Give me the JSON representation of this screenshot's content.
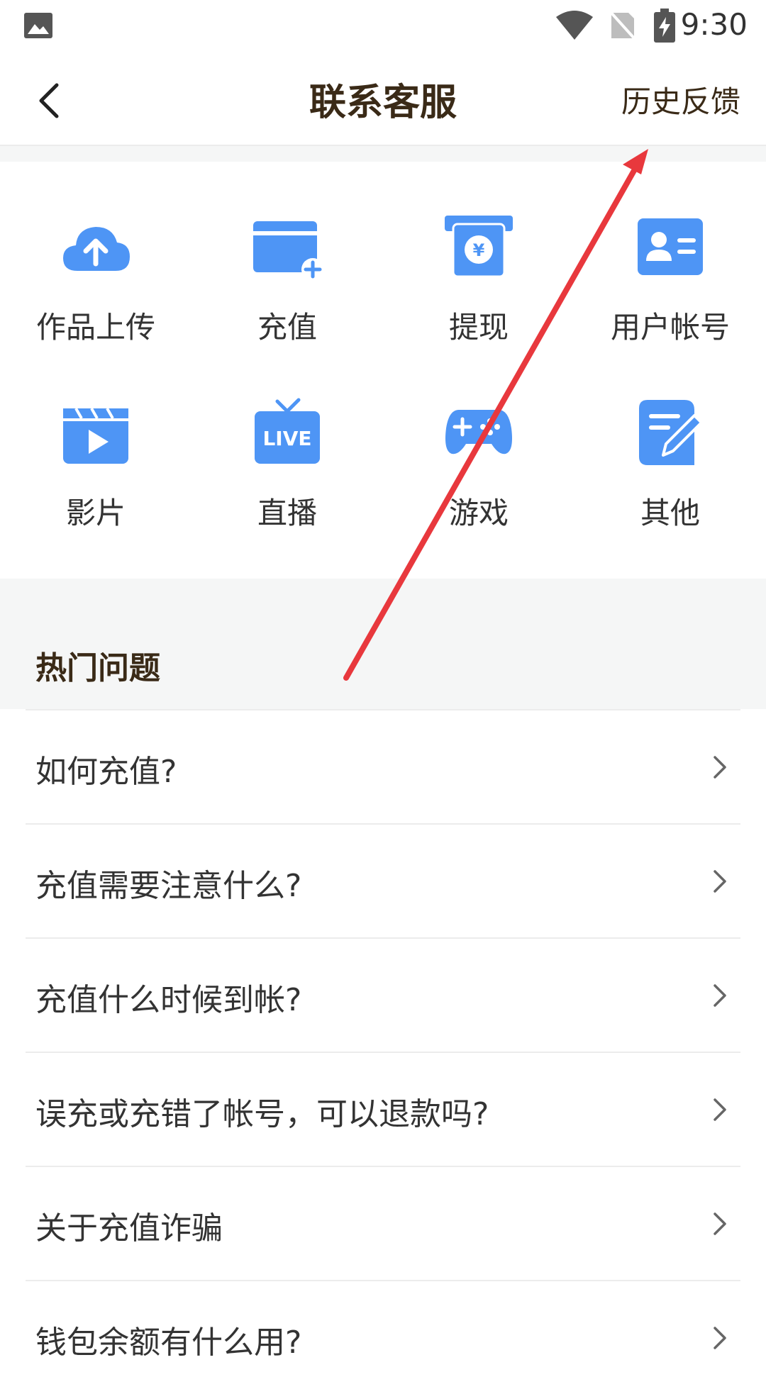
{
  "status_bar": {
    "time": "9:30"
  },
  "nav": {
    "title": "联系客服",
    "history_label": "历史反馈"
  },
  "categories": [
    {
      "label": "作品上传",
      "icon": "cloud-upload-icon"
    },
    {
      "label": "充值",
      "icon": "card-add-icon"
    },
    {
      "label": "提现",
      "icon": "cash-out-icon"
    },
    {
      "label": "用户帐号",
      "icon": "id-card-icon"
    },
    {
      "label": "影片",
      "icon": "movie-icon"
    },
    {
      "label": "直播",
      "icon": "live-tv-icon",
      "icon_text": "LIVE"
    },
    {
      "label": "游戏",
      "icon": "gamepad-icon"
    },
    {
      "label": "其他",
      "icon": "edit-note-icon"
    }
  ],
  "faq_section": {
    "heading": "热门问题",
    "items": [
      "如何充值?",
      "充值需要注意什么?",
      "充值什么时候到帐?",
      "误充或充错了帐号，可以退款吗?",
      "关于充值诈骗",
      "钱包余额有什么用?"
    ]
  },
  "colors": {
    "accent": "#4e95f5",
    "title_text": "#3a2a17",
    "annotation_arrow": "#e8383d"
  }
}
